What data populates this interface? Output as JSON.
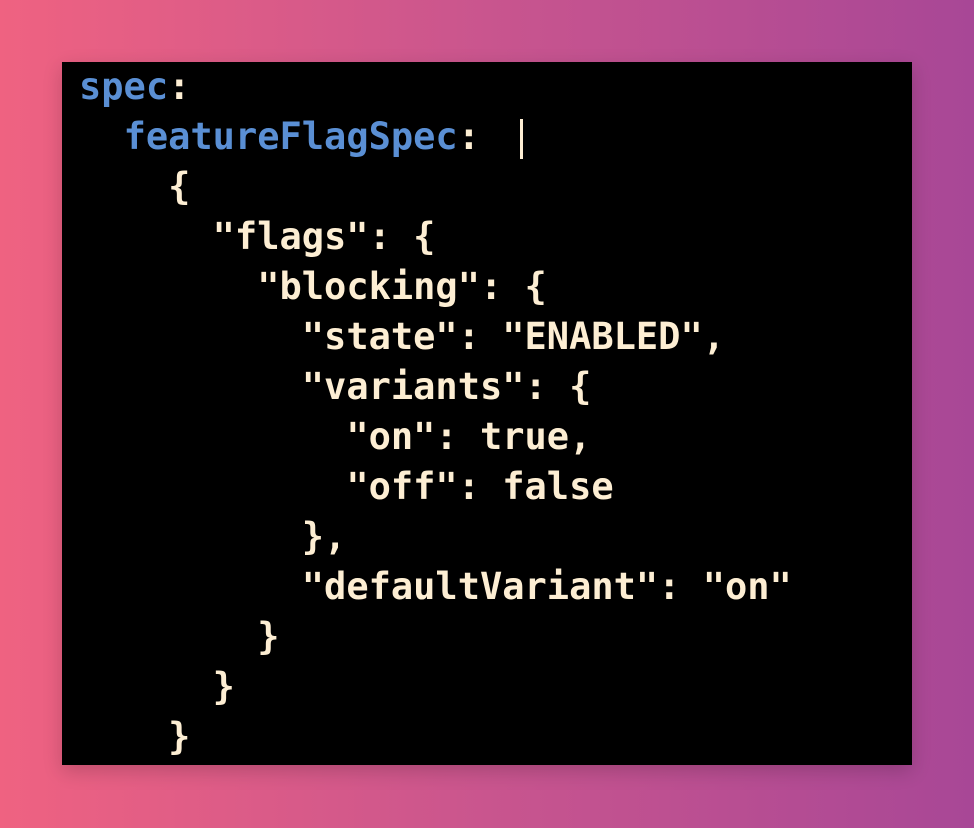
{
  "code": {
    "lines": [
      {
        "indent": "",
        "key": "spec",
        "rest": ":"
      },
      {
        "indent": "  ",
        "key": "featureFlagSpec",
        "rest": ": "
      },
      {
        "indent": "    ",
        "key": "",
        "rest": "{"
      },
      {
        "indent": "      ",
        "key": "",
        "rest": "\"flags\": {"
      },
      {
        "indent": "        ",
        "key": "",
        "rest": "\"blocking\": {"
      },
      {
        "indent": "          ",
        "key": "",
        "rest": "\"state\": \"ENABLED\","
      },
      {
        "indent": "          ",
        "key": "",
        "rest": "\"variants\": {"
      },
      {
        "indent": "            ",
        "key": "",
        "rest": "\"on\": true,"
      },
      {
        "indent": "            ",
        "key": "",
        "rest": "\"off\": false"
      },
      {
        "indent": "          ",
        "key": "",
        "rest": "},"
      },
      {
        "indent": "          ",
        "key": "",
        "rest": "\"defaultVariant\": \"on\""
      },
      {
        "indent": "        ",
        "key": "",
        "rest": "}"
      },
      {
        "indent": "      ",
        "key": "",
        "rest": "}"
      },
      {
        "indent": "    ",
        "key": "",
        "rest": "}"
      }
    ]
  },
  "colors": {
    "background_left": "#ef6281",
    "background_right": "#a84796",
    "editor_background": "#000000",
    "yaml_key": "#5a8fd4",
    "text": "#fdeed3"
  }
}
